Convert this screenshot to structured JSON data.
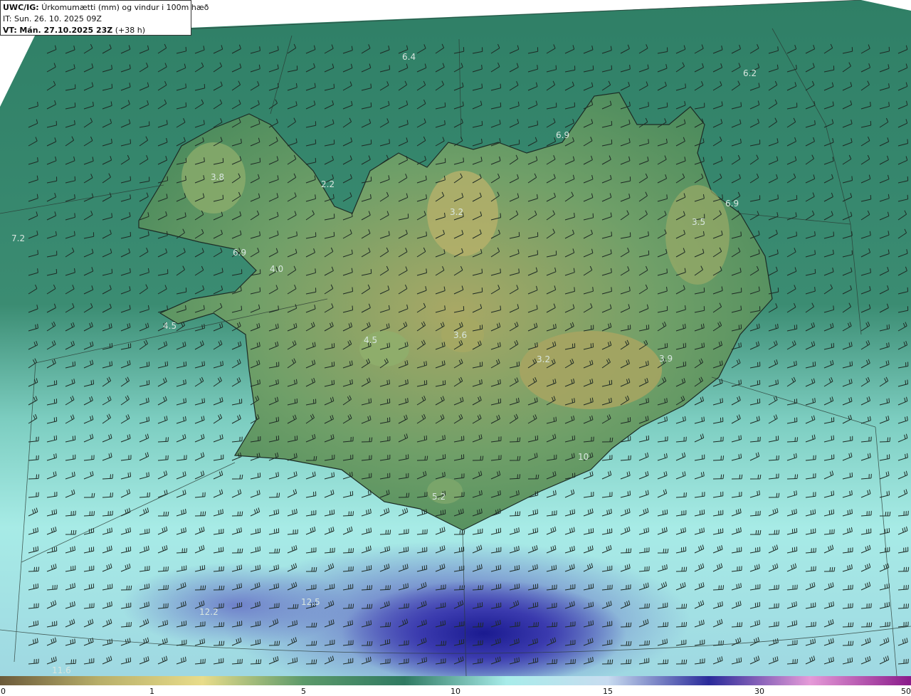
{
  "header": {
    "model": "UWC/IG:",
    "title": "Úrkomumætti (mm) og vindur i 100m hæð",
    "it_label": "IT:",
    "it_value": "Sun. 26. 10. 2025 09Z",
    "vt_label": "VT:",
    "vt_value": "Mán. 27.10.2025 23Z",
    "vt_offset": "(+38 h)"
  },
  "value_labels": [
    {
      "text": "6.4"
    },
    {
      "text": "6.2"
    },
    {
      "text": "6.9"
    },
    {
      "text": "3.8"
    },
    {
      "text": "2.2"
    },
    {
      "text": "3.2"
    },
    {
      "text": "6.9"
    },
    {
      "text": "3.5"
    },
    {
      "text": "7.2"
    },
    {
      "text": "6.9"
    },
    {
      "text": "4.0"
    },
    {
      "text": "4.5"
    },
    {
      "text": "4.5"
    },
    {
      "text": "3.6"
    },
    {
      "text": "3.2"
    },
    {
      "text": "3.9"
    },
    {
      "text": "10"
    },
    {
      "text": "5.2"
    },
    {
      "text": "12.5"
    },
    {
      "text": "12.2"
    },
    {
      "text": "11.6"
    }
  ],
  "colorbar": {
    "ticks": [
      "0",
      "1",
      "5",
      "10",
      "15",
      "30",
      "50"
    ],
    "colors": [
      "#6b5a3a",
      "#b9b06a",
      "#e8dc8a",
      "#5c9a6a",
      "#2f7a62",
      "#a8ecea",
      "#c8dcf0",
      "#2a2a9a",
      "#e59ad8",
      "#8a1a8a"
    ]
  },
  "colors": {
    "land_high": "#b5ad6a",
    "land_low": "#4a8f5a",
    "sea": "#3a8a6e",
    "light_precip": "#9fe0d8",
    "heavy_precip": "#2c2ca0"
  }
}
